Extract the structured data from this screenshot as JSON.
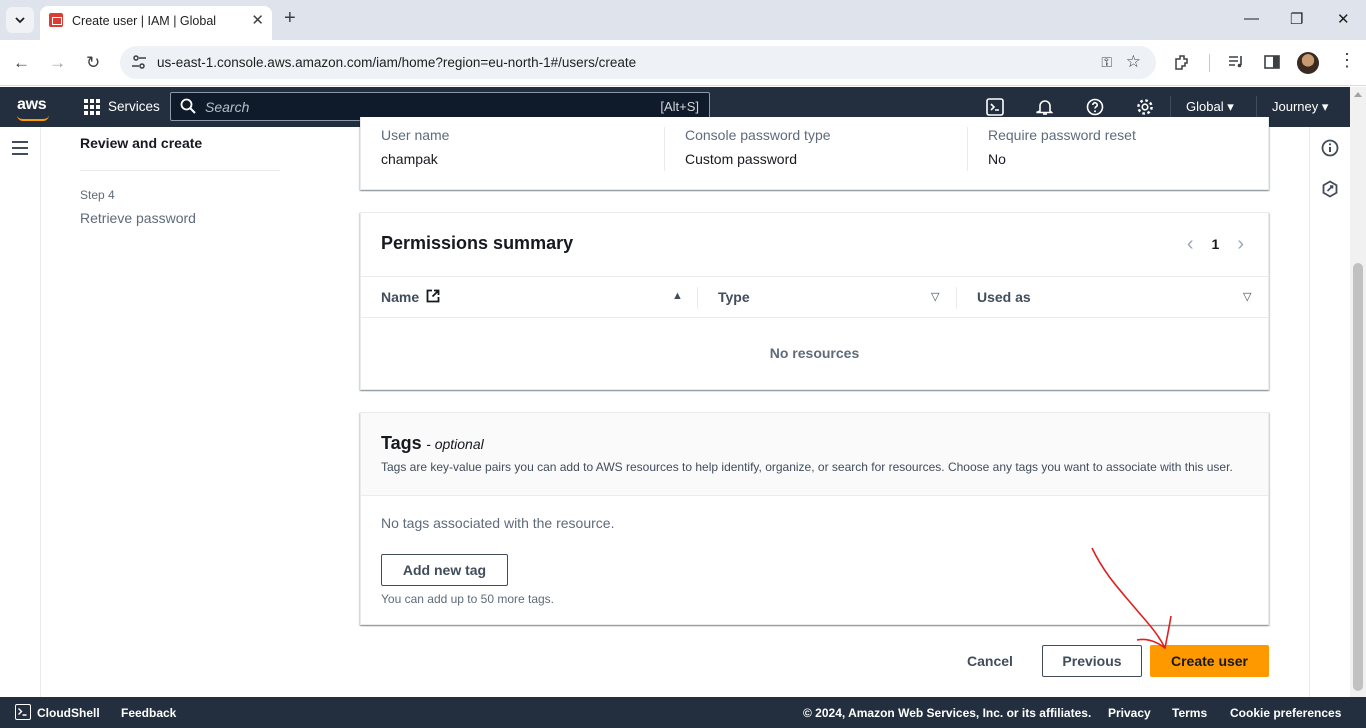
{
  "browser": {
    "tab_title": "Create user | IAM | Global",
    "url": "us-east-1.console.aws.amazon.com/iam/home?region=eu-north-1#/users/create"
  },
  "aws_nav": {
    "logo": "aws",
    "services": "Services",
    "search_placeholder": "Search",
    "search_shortcut": "[Alt+S]",
    "region": "Global",
    "account": "Journey"
  },
  "steps": {
    "current": "Review and create",
    "next_number": "Step 4",
    "next_name": "Retrieve password"
  },
  "user_details": {
    "fields": [
      {
        "label": "User name",
        "value": "champak"
      },
      {
        "label": "Console password type",
        "value": "Custom password"
      },
      {
        "label": "Require password reset",
        "value": "No"
      }
    ]
  },
  "permissions": {
    "title": "Permissions summary",
    "page": "1",
    "columns": [
      "Name",
      "Type",
      "Used as"
    ],
    "empty": "No resources"
  },
  "tags": {
    "title": "Tags",
    "optional": "- optional",
    "description": "Tags are key-value pairs you can add to AWS resources to help identify, organize, or search for resources. Choose any tags you want to associate with this user.",
    "empty": "No tags associated with the resource.",
    "add_button": "Add new tag",
    "limit": "You can add up to 50 more tags."
  },
  "actions": {
    "cancel": "Cancel",
    "previous": "Previous",
    "create": "Create user"
  },
  "footer": {
    "cloudshell": "CloudShell",
    "feedback": "Feedback",
    "copyright": "© 2024, Amazon Web Services, Inc. or its affiliates.",
    "privacy": "Privacy",
    "terms": "Terms",
    "cookies": "Cookie preferences"
  },
  "colors": {
    "aws_nav": "#232f3e",
    "primary_button": "#ff9900",
    "annotation": "#e02020"
  }
}
